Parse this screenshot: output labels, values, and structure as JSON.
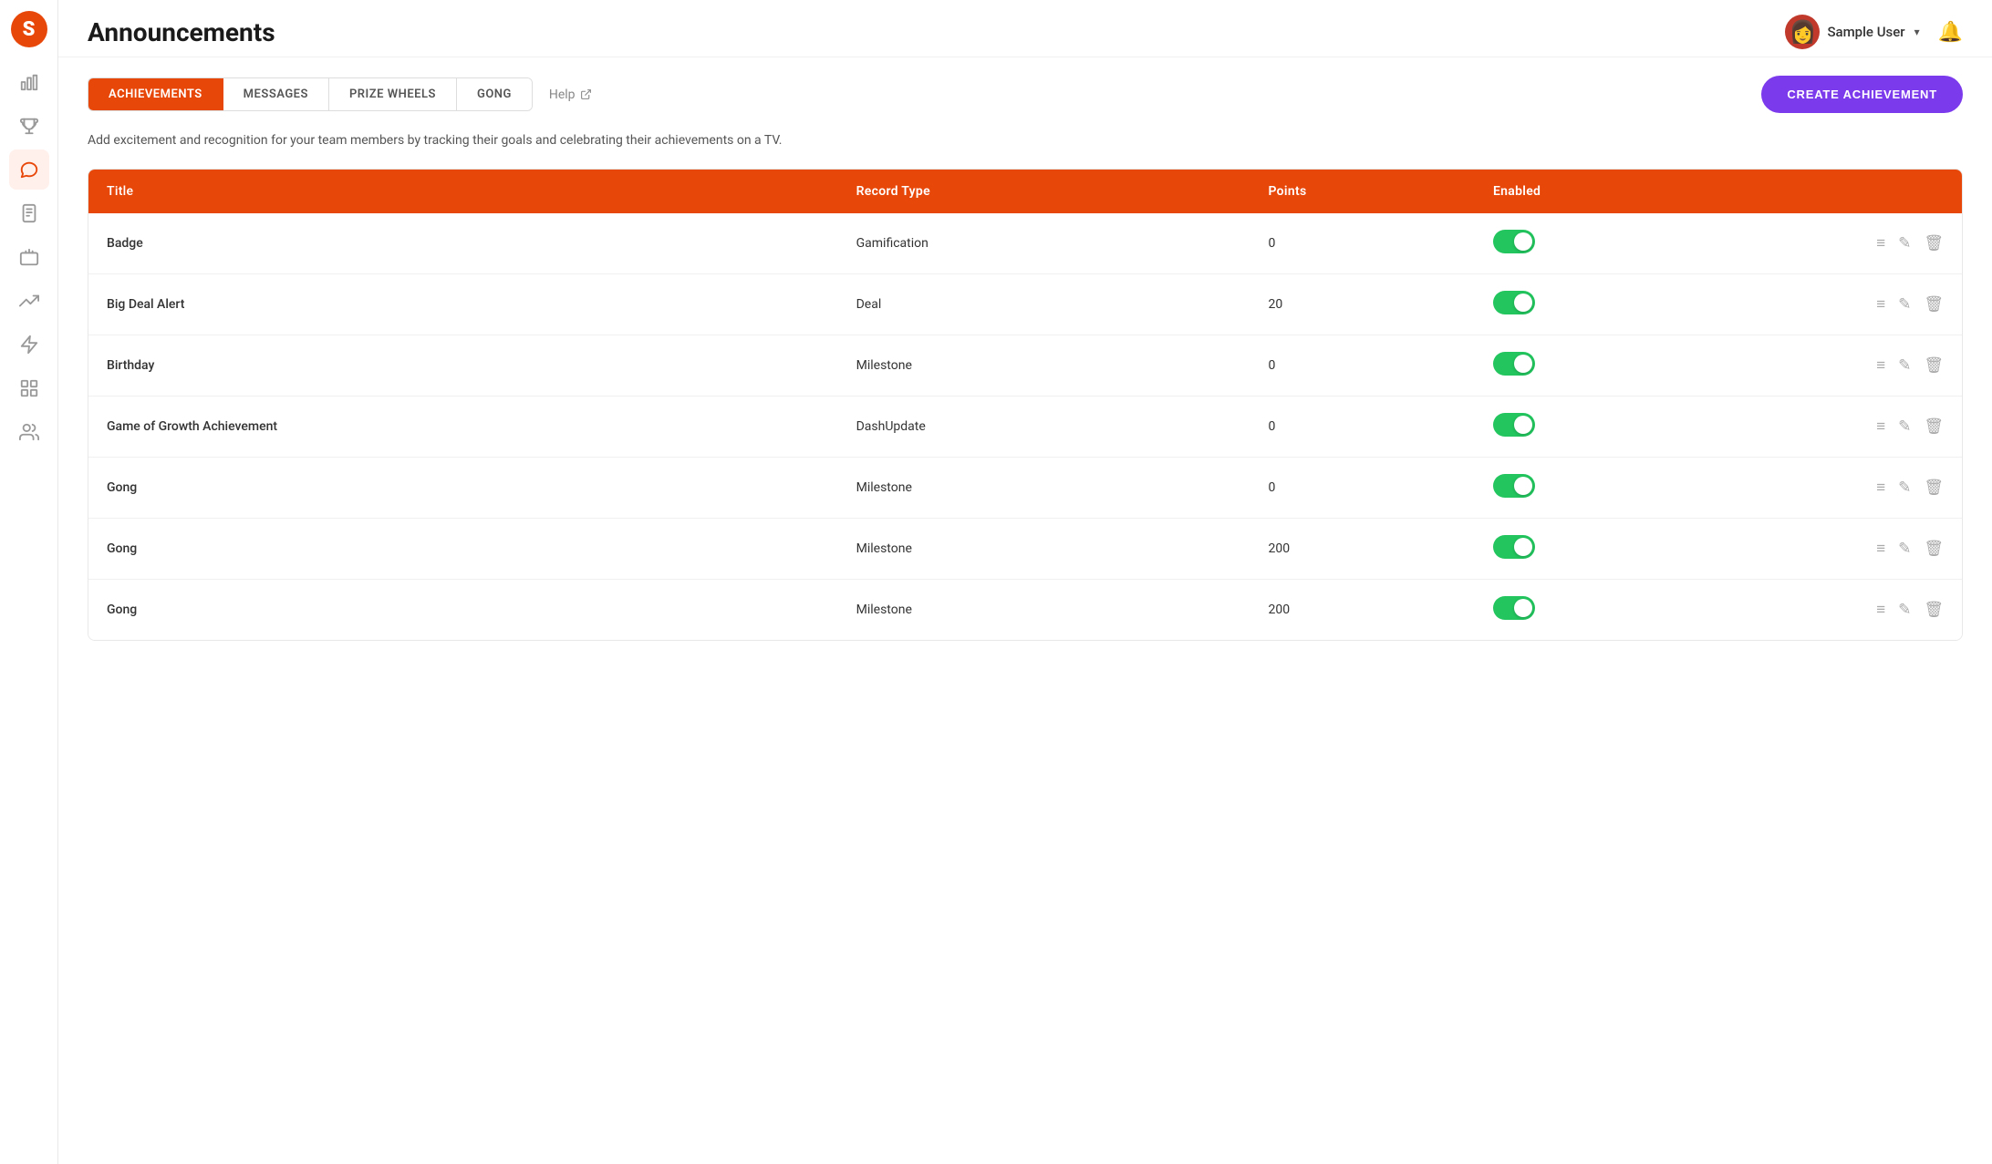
{
  "app": {
    "logo": "S",
    "title": "Announcements"
  },
  "header": {
    "user": {
      "name": "Sample User",
      "avatar_emoji": "👩"
    }
  },
  "tabs": {
    "items": [
      {
        "label": "ACHIEVEMENTS",
        "active": true
      },
      {
        "label": "MESSAGES",
        "active": false
      },
      {
        "label": "PRIZE WHEELS",
        "active": false
      },
      {
        "label": "GONG",
        "active": false
      }
    ],
    "help_label": "Help"
  },
  "create_button_label": "CREATE ACHIEVEMENT",
  "description": "Add excitement and recognition for your team members by tracking their goals and celebrating their achievements on a TV.",
  "table": {
    "columns": [
      {
        "key": "title",
        "label": "Title"
      },
      {
        "key": "record_type",
        "label": "Record Type"
      },
      {
        "key": "points",
        "label": "Points"
      },
      {
        "key": "enabled",
        "label": "Enabled"
      }
    ],
    "rows": [
      {
        "title": "Badge",
        "record_type": "Gamification",
        "points": "0",
        "enabled": true
      },
      {
        "title": "Big Deal Alert",
        "record_type": "Deal",
        "points": "20",
        "enabled": true
      },
      {
        "title": "Birthday",
        "record_type": "Milestone",
        "points": "0",
        "enabled": true
      },
      {
        "title": "Game of Growth Achievement",
        "record_type": "DashUpdate",
        "points": "0",
        "enabled": true
      },
      {
        "title": "Gong",
        "record_type": "Milestone",
        "points": "0",
        "enabled": true
      },
      {
        "title": "Gong",
        "record_type": "Milestone",
        "points": "200",
        "enabled": true
      },
      {
        "title": "Gong",
        "record_type": "Milestone",
        "points": "200",
        "enabled": true
      }
    ]
  },
  "sidebar": {
    "items": [
      {
        "name": "bar-chart-icon",
        "icon": "chart-bar"
      },
      {
        "name": "trophy-icon",
        "icon": "trophy"
      },
      {
        "name": "announcements-icon",
        "icon": "megaphone",
        "active": true
      },
      {
        "name": "reports-icon",
        "icon": "clipboard"
      },
      {
        "name": "tv-icon",
        "icon": "monitor"
      },
      {
        "name": "analytics-icon",
        "icon": "trending-up"
      },
      {
        "name": "integrations-icon",
        "icon": "zap"
      },
      {
        "name": "groups-icon",
        "icon": "grid"
      },
      {
        "name": "users-icon",
        "icon": "users"
      }
    ]
  },
  "colors": {
    "orange": "#e8470a",
    "purple": "#7c3aed",
    "green": "#22c55e"
  }
}
